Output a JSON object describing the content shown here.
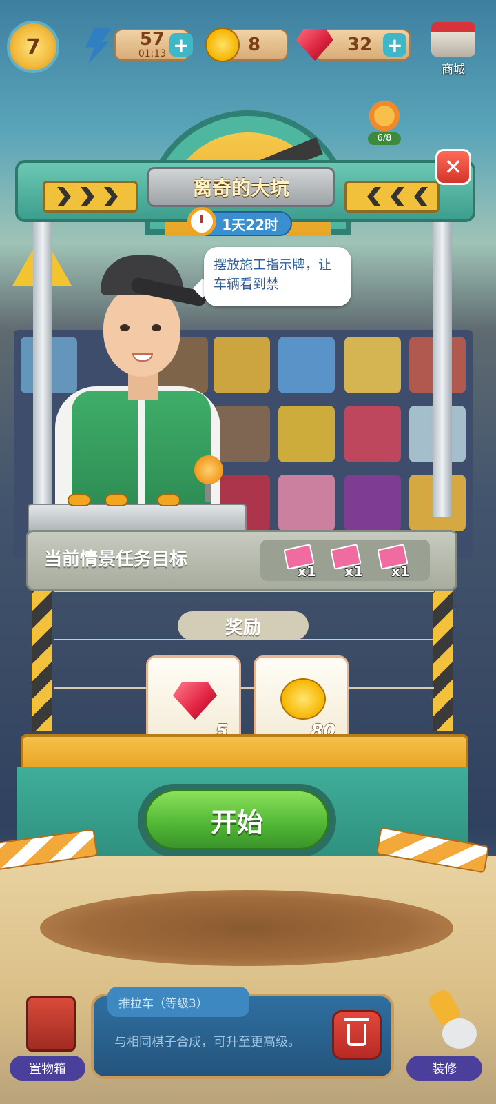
{
  "hud": {
    "level": "7",
    "energy": {
      "value": "57",
      "timer": "01:13"
    },
    "coins": "8",
    "gems": "32",
    "shop_label": "商城",
    "flower_progress": "6/8"
  },
  "popup": {
    "title": "离奇的大坑",
    "time_left": "1天22时",
    "speech": "摆放施工指示牌，让车辆看到禁",
    "task_label": "当前情景任务目标",
    "task_items": [
      {
        "icon": "construction-sign-icon",
        "qty": "x1"
      },
      {
        "icon": "construction-sign-icon",
        "qty": "x1"
      },
      {
        "icon": "construction-sign-icon",
        "qty": "x1"
      }
    ],
    "reward_title": "奖励",
    "rewards": [
      {
        "icon": "gem-icon",
        "qty": "5"
      },
      {
        "icon": "coin-icon",
        "qty": "80"
      }
    ],
    "start_label": "开始",
    "close_icon": "close-icon"
  },
  "bottom": {
    "item_name": "推拉车（等级3）",
    "item_desc": "与相同棋子合成，可升至更高级。",
    "storage_label": "置物箱",
    "decorate_label": "装修"
  },
  "colors": {
    "accent_teal": "#3fae9a",
    "start_green": "#4fb634",
    "close_red": "#d3352a",
    "hazard_yellow": "#f3c13c"
  }
}
